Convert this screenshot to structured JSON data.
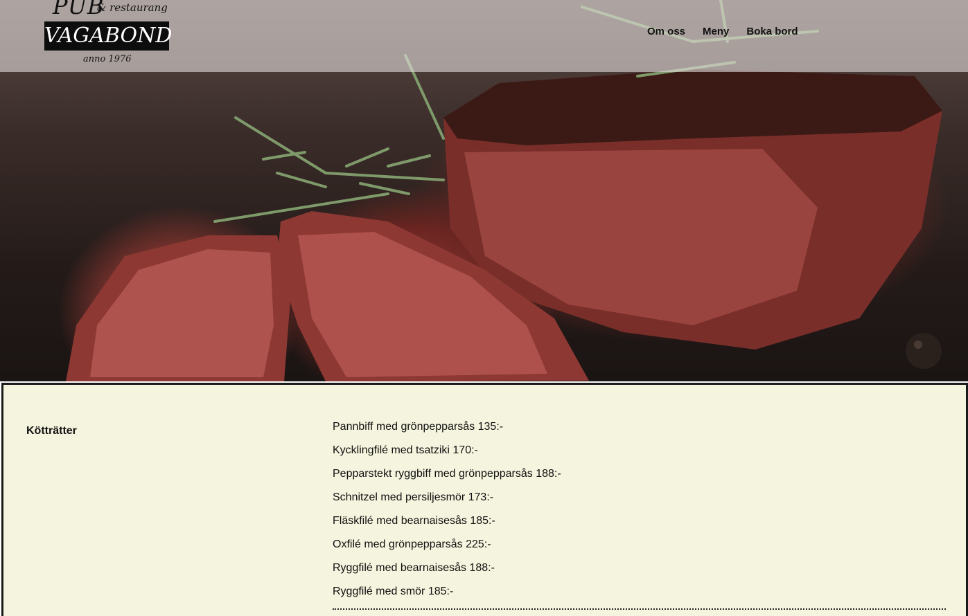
{
  "logo": {
    "line1": "PUB",
    "line1_suffix": "& restaurang",
    "name": "VAGABOND",
    "tagline": "anno 1976"
  },
  "nav": [
    {
      "label": "Om oss"
    },
    {
      "label": "Meny"
    },
    {
      "label": "Boka bord"
    }
  ],
  "hero": {
    "image": "steak-with-rosemary-photo"
  },
  "menu": {
    "category": "Kötträtter",
    "items": [
      "Pannbiff med grönpepparsås 135:-",
      "Kycklingfilé med tsatziki 170:-",
      "Pepparstekt ryggbiff med grönpepparsås 188:-",
      "Schnitzel med persiljesmör 173:-",
      "Fläskfilé med bearnaisesås 185:-",
      "Oxfilé med grönpepparsås 225:-",
      "Ryggfilé med bearnaisesås 188:-",
      "Ryggfilé med smör 185:-"
    ]
  }
}
